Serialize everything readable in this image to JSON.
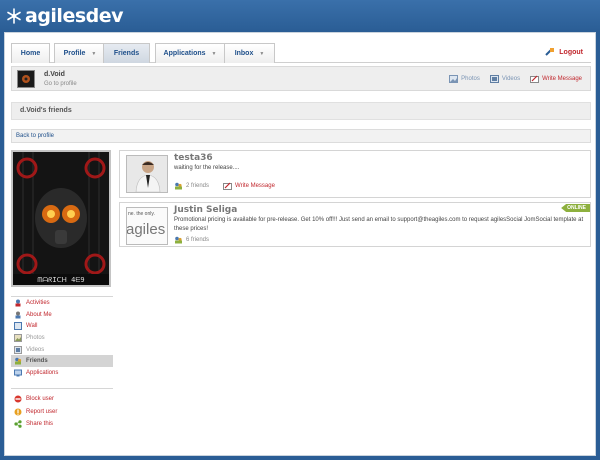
{
  "brand": {
    "name": "agilesdev"
  },
  "nav": {
    "tabs": [
      {
        "label": "Home"
      },
      {
        "label": "Profile"
      },
      {
        "label": "Friends"
      },
      {
        "label": "Applications"
      },
      {
        "label": "Inbox"
      }
    ],
    "logout_label": "Logout"
  },
  "userbar": {
    "name": "d.Void",
    "subtitle": "Go to profile",
    "links": {
      "photos": "Photos",
      "videos": "Videos",
      "write_message": "Write Message"
    }
  },
  "page_title": "d.Void's friends",
  "back_link": "Back to profile",
  "profile_image": {
    "caption": "ᗰᗩᖇIᑕᕼ 4ᗴ9"
  },
  "sidebar": {
    "menu": [
      {
        "label": "Activities",
        "icon": "activities-icon"
      },
      {
        "label": "About Me",
        "icon": "about-me-icon"
      },
      {
        "label": "Wall",
        "icon": "wall-icon"
      },
      {
        "label": "Photos",
        "icon": "photos-icon"
      },
      {
        "label": "Videos",
        "icon": "videos-icon"
      },
      {
        "label": "Friends",
        "icon": "friends-icon",
        "active": true
      },
      {
        "label": "Applications",
        "icon": "applications-icon"
      }
    ],
    "actions": [
      {
        "label": "Block user",
        "icon": "block-icon"
      },
      {
        "label": "Report user",
        "icon": "report-icon"
      },
      {
        "label": "Share this",
        "icon": "share-icon"
      }
    ]
  },
  "friends": [
    {
      "name": "testa36",
      "status": "waiting for the release....",
      "friends_count": "2 friends",
      "write_message": "Write Message"
    },
    {
      "name": "Justin Seliga",
      "thumb_text": "ne. the only.",
      "thumb_logo": "agiles",
      "description": "Promotional pricing is available for pre-release. Get 10% off!!! Just send an email to support@theagiles.com to request agilesSocial JomSocial template at these prices!",
      "friends_count": "6 friends",
      "badge": "ONLINE"
    }
  ],
  "colors": {
    "brand_blue": "#2a5d95",
    "link_red": "#c1272d",
    "online_green": "#8db03e"
  }
}
